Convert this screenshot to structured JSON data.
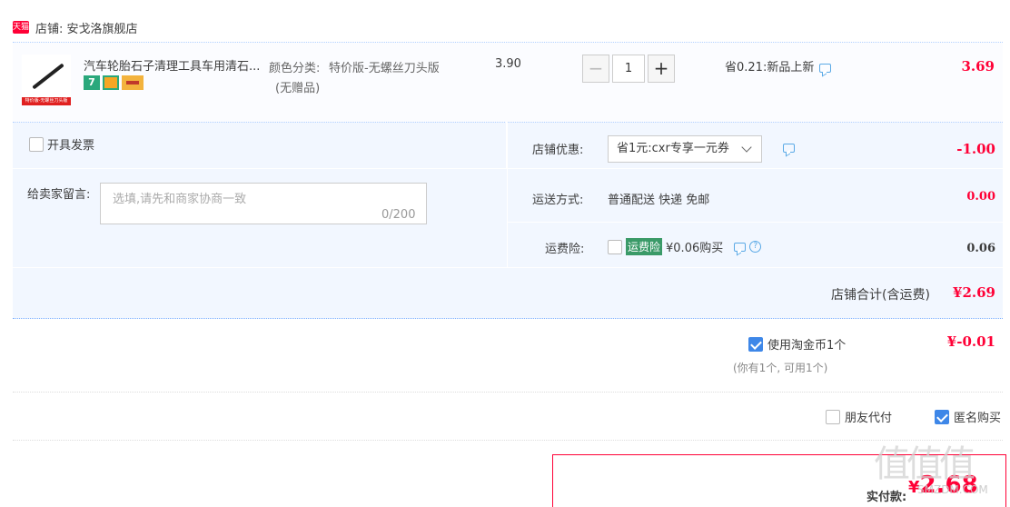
{
  "shop": {
    "badge": "天猫",
    "label": "店铺: 安戈洛旗舰店"
  },
  "item": {
    "thumb_tag": "特价版-无螺丝刀头版",
    "title": "汽车轮胎石子清理工具车用清石...",
    "icons": [
      "seven-day-return-icon",
      "guarantee-icon",
      "credit-card-icon"
    ],
    "sku_label": "颜色分类:",
    "sku_value": "特价版-无螺丝刀头版",
    "sku_sub": "(无赠品)",
    "unit_price": "3.90",
    "quantity": "1",
    "minus": "−",
    "plus": "+",
    "promo": "省0.21:新品上新",
    "total": "3.69"
  },
  "invoice": {
    "label": "开具发票"
  },
  "message": {
    "label": "给卖家留言:",
    "placeholder": "选填,请先和商家协商一致",
    "count": "0/200"
  },
  "coupon": {
    "label": "店铺优惠:",
    "selected": "省1元:cxr专享一元券",
    "amount": "-1.00"
  },
  "shipping": {
    "label": "运送方式:",
    "value": "普通配送 快递 免邮",
    "amount": "0.00"
  },
  "insurance": {
    "label": "运费险:",
    "badge": "运费险",
    "price": "¥0.06购买",
    "help": "?",
    "amount": "0.06"
  },
  "shop_total": {
    "label": "店铺合计(含运费)",
    "amount": "¥2.69"
  },
  "coins": {
    "label": "使用淘金币1个",
    "amount": "¥-0.01",
    "sub": "(你有1个, 可用1个)"
  },
  "friend_pay": {
    "label": "朋友代付"
  },
  "anonymous": {
    "label": "匿名购买"
  },
  "pay": {
    "label": "实付款:",
    "currency": "¥",
    "amount": "2.68"
  },
  "watermark": {
    "text": "值值值",
    "sub": "SMZDM.COM"
  },
  "colors": {
    "accent": "#ff0036",
    "panel": "#f2f7ff",
    "check": "#3e87e8",
    "insurance": "#3a9a68"
  }
}
